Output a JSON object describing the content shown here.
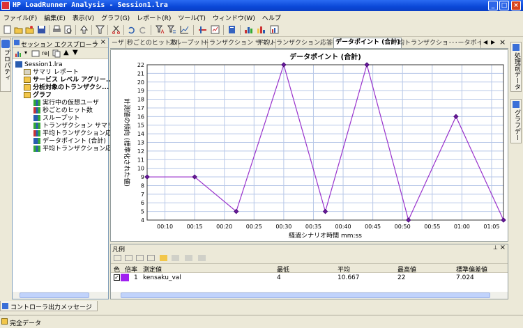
{
  "window": {
    "title": "HP LoadRunner Analysis - Session1.lra"
  },
  "menu": [
    "ファイル(F)",
    "編集(E)",
    "表示(V)",
    "グラフ(G)",
    "レポート(R)",
    "ツール(T)",
    "ウィンドウ(W)",
    "ヘルプ"
  ],
  "left_tab": "プロパティ",
  "explorer": {
    "title": "セッション エクスプローラ",
    "tree": [
      {
        "label": "Session1.lra",
        "level": 0,
        "bold": false
      },
      {
        "label": "サマリ レポート",
        "level": 1,
        "bold": false
      },
      {
        "label": "サービス レベル アグリー...",
        "level": 1,
        "bold": true
      },
      {
        "label": "分析対象のトランザクシ...",
        "level": 1,
        "bold": true
      },
      {
        "label": "グラフ",
        "level": 1,
        "bold": true
      },
      {
        "label": "実行中の仮想ユーザ",
        "level": 2,
        "bold": false
      },
      {
        "label": "秒ごとのヒット数",
        "level": 2,
        "bold": false
      },
      {
        "label": "スループット",
        "level": 2,
        "bold": false
      },
      {
        "label": "トランザクション サマリ",
        "level": 2,
        "bold": false
      },
      {
        "label": "平均トランザクション応...",
        "level": 2,
        "bold": false
      },
      {
        "label": "データポイント (合計)",
        "level": 2,
        "bold": false
      },
      {
        "label": "平均トランザクション応...",
        "level": 2,
        "bold": false
      }
    ]
  },
  "tabs": [
    {
      "label": "ーザ",
      "active": false
    },
    {
      "label": "秒ごとのヒット数",
      "active": false
    },
    {
      "label": "スループット",
      "active": false
    },
    {
      "label": "トランザクション サマリ",
      "active": false
    },
    {
      "label": "平均トランザクション応答時間",
      "active": false
    },
    {
      "label": "データポイント (合計)",
      "active": true
    },
    {
      "label": "平均トランザクショ･･･ータポイント (合",
      "active": false
    }
  ],
  "right_tabs": [
    "処理前データ",
    "グラフデー"
  ],
  "chart_data": {
    "type": "line",
    "title": "データポイント (合計)",
    "xlabel": "経過シナリオ時間 mm:ss",
    "ylabel": "計測値の傾向 (標準化された値)",
    "ylim": [
      4,
      22
    ],
    "yticks": [
      4,
      5,
      6,
      7,
      8,
      9,
      10,
      11,
      12,
      13,
      14,
      15,
      16,
      17,
      18,
      19,
      20,
      21,
      22
    ],
    "xlim": [
      7,
      67
    ],
    "xticks": [
      10,
      15,
      20,
      25,
      30,
      35,
      40,
      45,
      50,
      55,
      60,
      65
    ],
    "xtick_labels": [
      "00:10",
      "00:15",
      "00:20",
      "00:25",
      "00:30",
      "00:35",
      "00:40",
      "00:45",
      "00:50",
      "00:55",
      "01:00",
      "01:05"
    ],
    "grid": true,
    "series": [
      {
        "name": "kensaku_val",
        "color": "#9933cc",
        "x": [
          7,
          15,
          22,
          30,
          37,
          44,
          51,
          59,
          67
        ],
        "y": [
          9,
          9,
          5,
          22,
          5,
          22,
          4,
          16,
          4
        ]
      }
    ]
  },
  "legend": {
    "title": "凡例",
    "columns": [
      "色",
      "倍率",
      "測定値",
      "最低",
      "平均",
      "最高値",
      "標準偏差値"
    ],
    "rows": [
      {
        "color": "#a020f0",
        "scale": "1",
        "measure": "kensaku_val",
        "min": "4",
        "avg": "10.667",
        "max": "22",
        "std": "7.024"
      }
    ]
  },
  "bottom_tab": "コントローラ出力メッセージ",
  "status": "完全データ"
}
